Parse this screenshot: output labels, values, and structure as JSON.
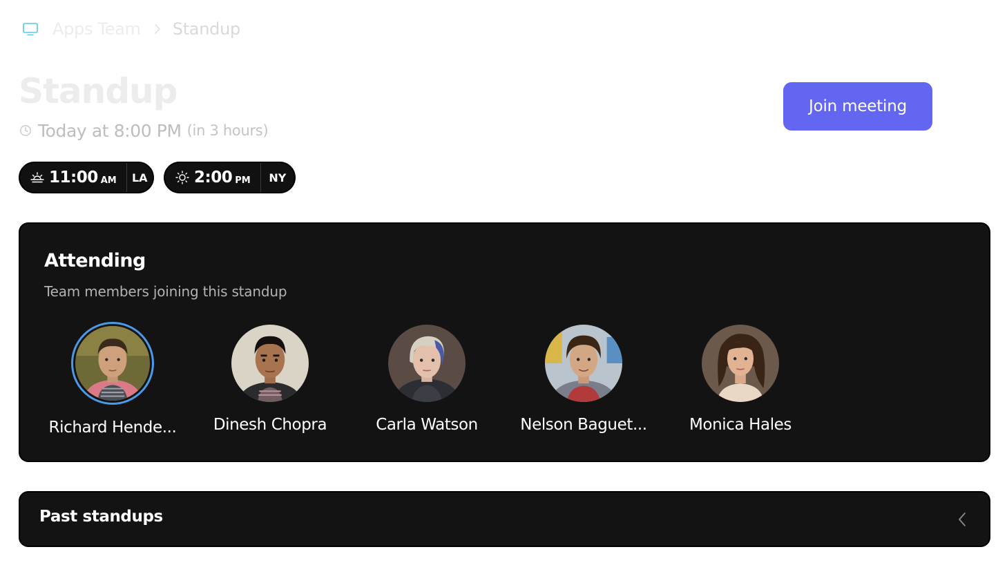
{
  "breadcrumb": {
    "icon": "monitor-icon",
    "team": "Apps Team",
    "current": "Standup"
  },
  "meeting": {
    "title": "Standup",
    "time": "Today at 8:00 PM",
    "relative": "(in 3 hours)",
    "join_label": "Join meeting",
    "accent_color": "#6366f1"
  },
  "timezones": [
    {
      "icon": "sunrise-icon",
      "time": "11:00",
      "ampm": "AM",
      "city": "LA"
    },
    {
      "icon": "sun-icon",
      "time": "2:00",
      "ampm": "PM",
      "city": "NY"
    }
  ],
  "attending": {
    "title": "Attending",
    "subtitle": "Team members joining this standup",
    "members": [
      {
        "name": "Richard Hende...",
        "selected": true
      },
      {
        "name": "Dinesh Chopra",
        "selected": false
      },
      {
        "name": "Carla Watson",
        "selected": false
      },
      {
        "name": "Nelson Baguet...",
        "selected": false
      },
      {
        "name": "Monica Hales",
        "selected": false
      }
    ]
  },
  "past": {
    "title": "Past standups",
    "chevron_icon": "chevron-left-icon"
  }
}
